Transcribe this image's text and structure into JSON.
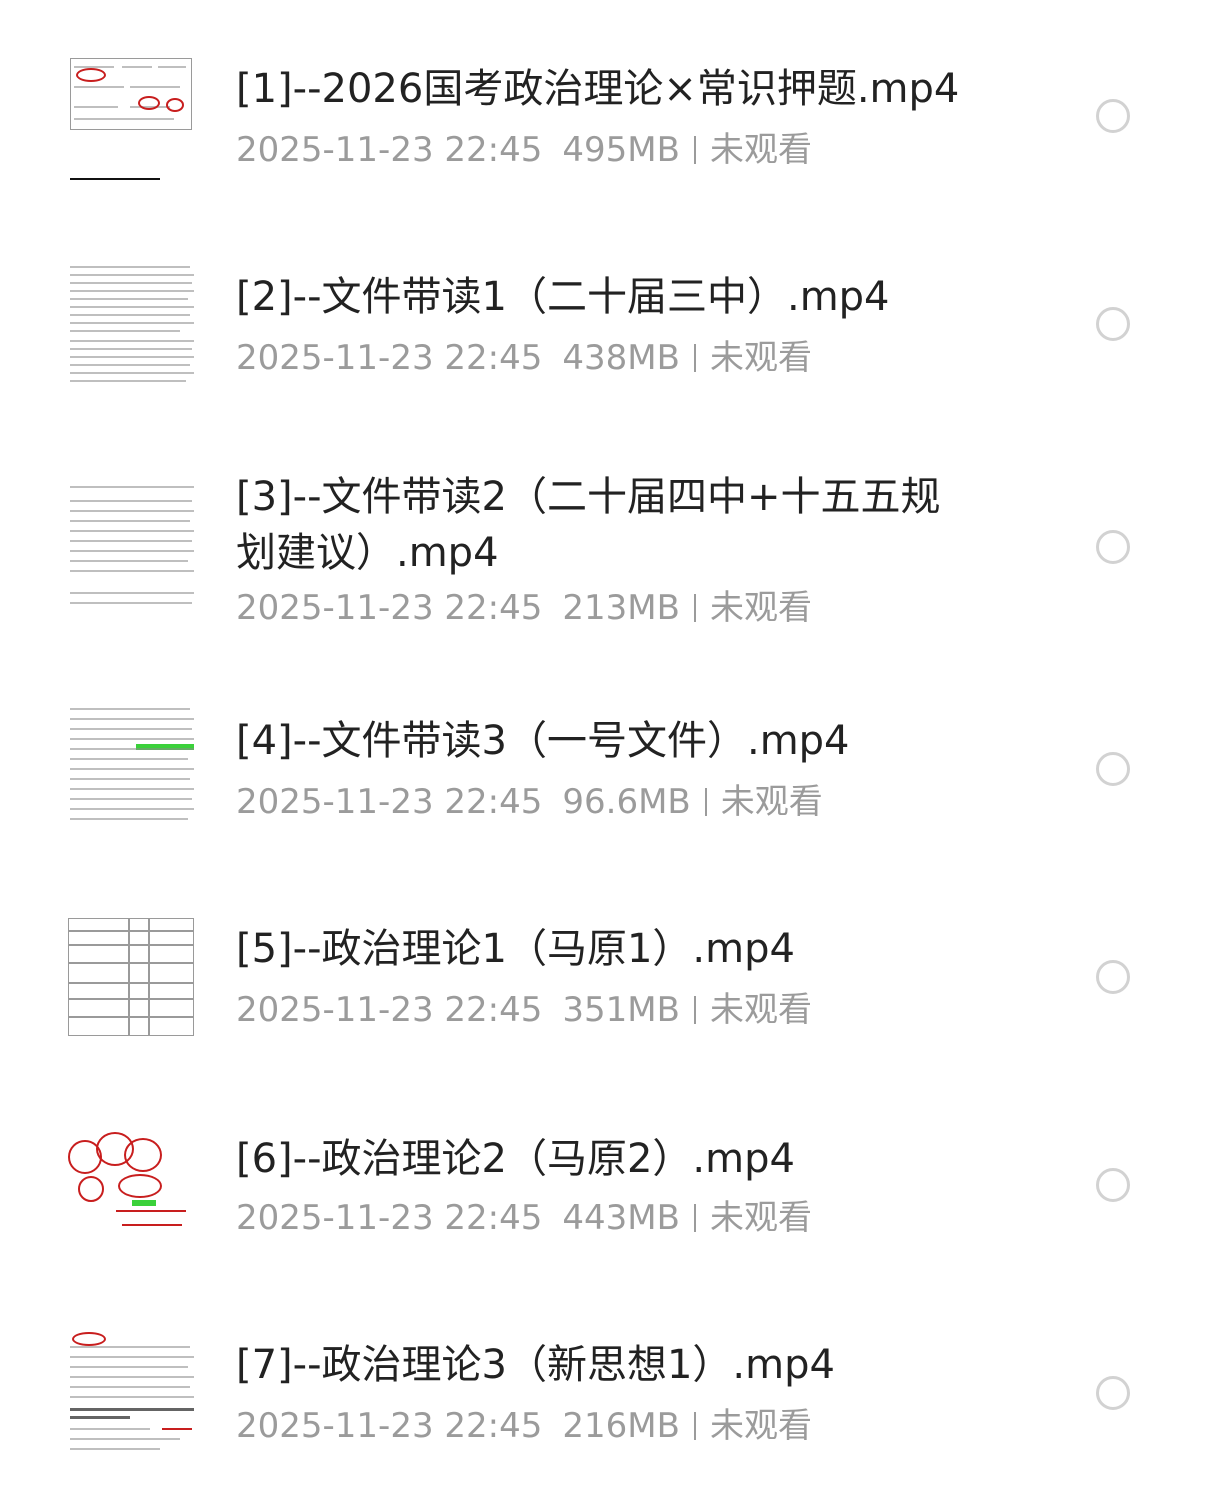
{
  "files": [
    {
      "title": "[1]--2026国考政治理论×常识押题.mp4",
      "date": "2025-11-23 22:45",
      "size": "495MB",
      "status": "未观看",
      "thumb_icon": "annotated-table-thumbnail-icon"
    },
    {
      "title": "[2]--文件带读1（二十届三中）.mp4",
      "date": "2025-11-23 22:45",
      "size": "438MB",
      "status": "未观看",
      "thumb_icon": "document-page-thumbnail-icon"
    },
    {
      "title_line1": "[3]--文件带读2（二十届四中+十五五规",
      "title_line2": "划建议）.mp4",
      "date": "2025-11-23 22:45",
      "size": "213MB",
      "status": "未观看",
      "thumb_icon": "document-page-thumbnail-icon"
    },
    {
      "title": "[4]--文件带读3（一号文件）.mp4",
      "date": "2025-11-23 22:45",
      "size": "96.6MB",
      "status": "未观看",
      "thumb_icon": "highlighted-document-thumbnail-icon"
    },
    {
      "title": "[5]--政治理论1（马原1）.mp4",
      "date": "2025-11-23 22:45",
      "size": "351MB",
      "status": "未观看",
      "thumb_icon": "table-thumbnail-icon"
    },
    {
      "title": "[6]--政治理论2（马原2）.mp4",
      "date": "2025-11-23 22:45",
      "size": "443MB",
      "status": "未观看",
      "thumb_icon": "handwriting-thumbnail-icon"
    },
    {
      "title": "[7]--政治理论3（新思想1）.mp4",
      "date": "2025-11-23 22:45",
      "size": "216MB",
      "status": "未观看",
      "thumb_icon": "annotated-document-thumbnail-icon"
    }
  ],
  "colors": {
    "title": "#222222",
    "meta": "#9b9b9b",
    "radio_border": "#d2d2d2",
    "annotation_red": "#c81e1e",
    "highlight_green": "#3ad13a"
  }
}
